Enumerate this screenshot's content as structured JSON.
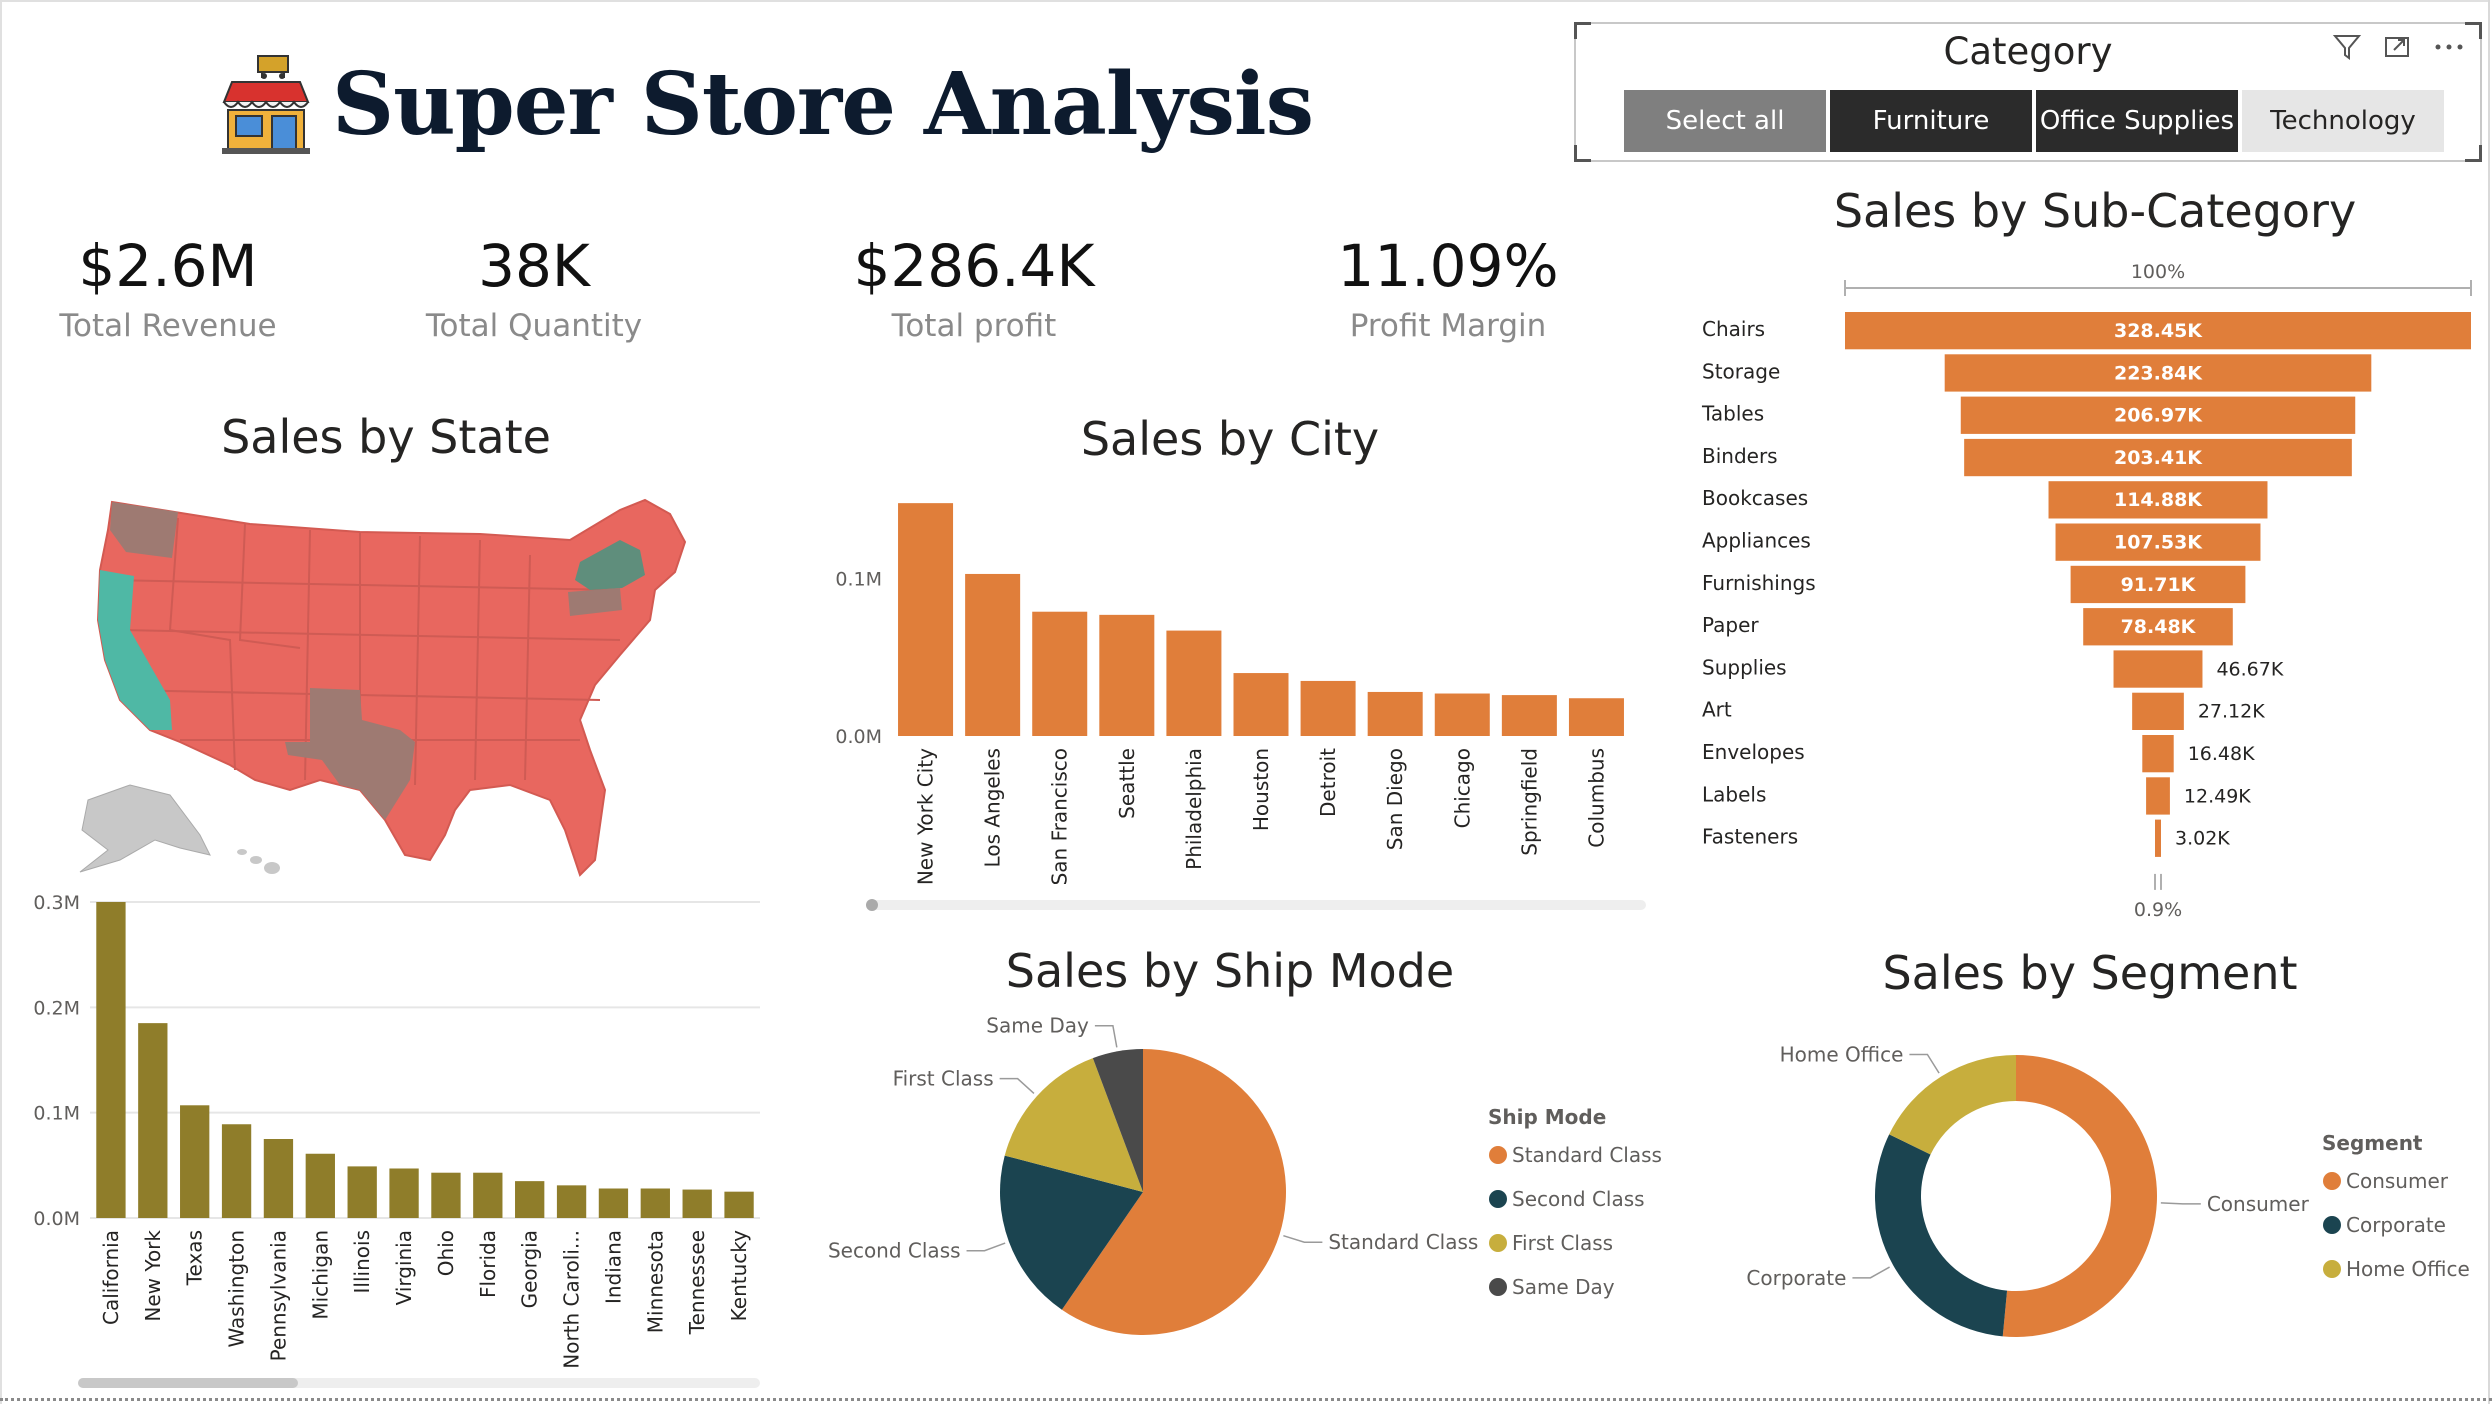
{
  "report": {
    "title": "Super Store Analysis"
  },
  "kpis": [
    {
      "value": "$2.6M",
      "label": "Total Revenue"
    },
    {
      "value": "38K",
      "label": "Total Quantity"
    },
    {
      "value": "$286.4K",
      "label": "Total profit"
    },
    {
      "value": "11.09%",
      "label": "Profit Margin"
    }
  ],
  "slicer": {
    "header": "Category",
    "buttons": [
      "Select all",
      "Furniture",
      "Office Supplies",
      "Technology"
    ],
    "selected": [
      "Furniture",
      "Office Supplies"
    ],
    "icons": [
      "filter-icon",
      "focus-mode-icon",
      "more-options-icon"
    ]
  },
  "colors": {
    "orange": "#E07E3A",
    "olive": "#8F7D2A",
    "dark_teal": "#1B4450",
    "mustard": "#C7AE3D",
    "gray": "#4A4A4A",
    "map_red": "#E8675F",
    "map_teal": "#4FB8A5",
    "map_brown": "#9E7A72",
    "map_green": "#5F8E7C"
  },
  "chart_data": [
    {
      "id": "map",
      "type": "map",
      "title": "Sales by State",
      "highlights": [
        {
          "state": "California",
          "color": "#4FB8A5"
        },
        {
          "state": "New York",
          "color": "#5F8E7C"
        },
        {
          "state": "Texas",
          "color": "#9E7A72"
        },
        {
          "state": "Washington",
          "color": "#9E7A72"
        },
        {
          "state": "Pennsylvania",
          "color": "#9E7A72"
        }
      ]
    },
    {
      "id": "state_bar",
      "type": "bar",
      "title": "",
      "categories": [
        "California",
        "New York",
        "Texas",
        "Washington",
        "Pennsylvania",
        "Michigan",
        "Illinois",
        "Virginia",
        "Ohio",
        "Florida",
        "Georgia",
        "North Caroli...",
        "Indiana",
        "Minnesota",
        "Tennessee",
        "Kentucky"
      ],
      "values": [
        0.3,
        0.185,
        0.107,
        0.089,
        0.075,
        0.061,
        0.049,
        0.047,
        0.043,
        0.043,
        0.035,
        0.031,
        0.028,
        0.028,
        0.027,
        0.025
      ],
      "y_ticks": [
        "0.0M",
        "0.1M",
        "0.2M",
        "0.3M"
      ],
      "ylim": [
        0,
        0.3
      ],
      "grid": true
    },
    {
      "id": "city_bar",
      "type": "bar",
      "title": "Sales by City",
      "categories": [
        "New York City",
        "Los Angeles",
        "San Francisco",
        "Seattle",
        "Philadelphia",
        "Houston",
        "Detroit",
        "San Diego",
        "Chicago",
        "Springfield",
        "Columbus"
      ],
      "values": [
        0.148,
        0.103,
        0.079,
        0.077,
        0.067,
        0.04,
        0.035,
        0.028,
        0.027,
        0.026,
        0.024
      ],
      "y_ticks": [
        "0.0M",
        "0.1M"
      ],
      "ylim": [
        0,
        0.15
      ],
      "grid": false
    },
    {
      "id": "funnel",
      "type": "bar",
      "title": "Sales by Sub-Category",
      "top_label": "100%",
      "bottom_label": "0.9%",
      "categories": [
        "Chairs",
        "Storage",
        "Tables",
        "Binders",
        "Bookcases",
        "Appliances",
        "Furnishings",
        "Paper",
        "Supplies",
        "Art",
        "Envelopes",
        "Labels",
        "Fasteners"
      ],
      "values": [
        328.45,
        223.84,
        206.97,
        203.41,
        114.88,
        107.53,
        91.71,
        78.48,
        46.67,
        27.12,
        16.48,
        12.49,
        3.02
      ],
      "labels": [
        "328.45K",
        "223.84K",
        "206.97K",
        "203.41K",
        "114.88K",
        "107.53K",
        "91.71K",
        "78.48K",
        "46.67K",
        "27.12K",
        "16.48K",
        "12.49K",
        "3.02K"
      ]
    },
    {
      "id": "ship_pie",
      "type": "pie",
      "title": "Sales by Ship Mode",
      "legend_title": "Ship Mode",
      "legend_position": "right",
      "categories": [
        "Standard Class",
        "Second Class",
        "First Class",
        "Same Day"
      ],
      "values": [
        59.6,
        19.5,
        15.2,
        5.7
      ],
      "colors": [
        "#E07E3A",
        "#1B4450",
        "#C7AE3D",
        "#4A4A4A"
      ]
    },
    {
      "id": "segment_donut",
      "type": "pie",
      "title": "Sales by Segment",
      "legend_title": "Segment",
      "legend_position": "right",
      "categories": [
        "Consumer",
        "Corporate",
        "Home Office"
      ],
      "values": [
        51.5,
        30.7,
        17.8
      ],
      "colors": [
        "#E07E3A",
        "#1B4450",
        "#C7AE3D"
      ]
    }
  ]
}
